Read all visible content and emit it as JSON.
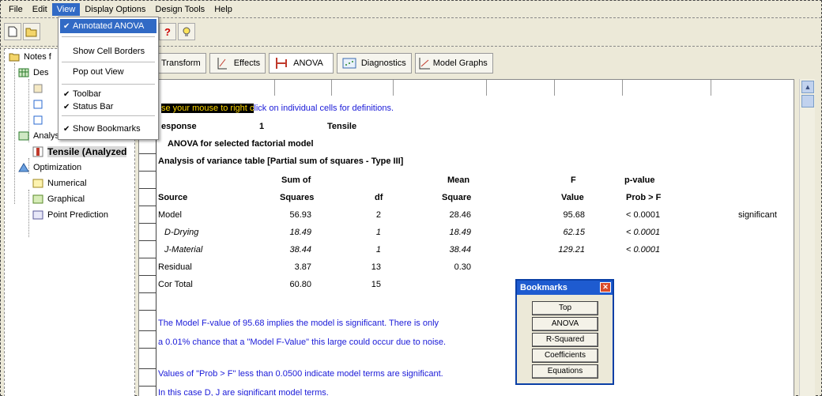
{
  "menubar": {
    "items": [
      "File",
      "Edit",
      "View",
      "Display Options",
      "Design Tools",
      "Help"
    ]
  },
  "view_menu": {
    "items": [
      {
        "label": "Annotated ANOVA",
        "checked": true
      },
      {
        "label": "Show Cell Borders",
        "checked": false
      },
      {
        "label": "Pop out View",
        "checked": false
      },
      {
        "label": "Toolbar",
        "checked": true
      },
      {
        "label": "Status Bar",
        "checked": true
      },
      {
        "label": "Show Bookmarks",
        "checked": true
      }
    ]
  },
  "tree": {
    "items": [
      {
        "label": "Notes f",
        "icon": "folder-icon"
      },
      {
        "label": "Des",
        "icon": "design-grid-icon"
      },
      {
        "label": "Analysis",
        "icon": "analysis-icon"
      },
      {
        "label": "Tensile (Analyzed",
        "icon": "tensile-icon"
      },
      {
        "label": "Optimization",
        "icon": "optimization-icon"
      },
      {
        "label": "Numerical",
        "icon": "numerical-icon"
      },
      {
        "label": "Graphical",
        "icon": "graphical-icon"
      },
      {
        "label": "Point Prediction",
        "icon": "point-prediction-icon"
      }
    ]
  },
  "tabs": [
    {
      "label": "Transform",
      "icon": "transform-icon"
    },
    {
      "label": "Effects",
      "icon": "effects-icon"
    },
    {
      "label": "ANOVA",
      "icon": "anova-icon"
    },
    {
      "label": "Diagnostics",
      "icon": "diagnostics-icon"
    },
    {
      "label": "Model Graphs",
      "icon": "model-graphs-icon"
    }
  ],
  "report": {
    "hint_prefix": "se your mouse to right c",
    "hint_suffix": "lick on individual cells for definitions.",
    "response_label": "esponse",
    "response_num": "1",
    "response_name": "Tensile",
    "model_title": "ANOVA for selected factorial model",
    "table_title": "Analysis of variance table [Partial sum of squares - Type III]",
    "head1": {
      "sum": "Sum of",
      "mean": "Mean",
      "f": "F",
      "p": "p-value"
    },
    "head2": {
      "source": "Source",
      "sum": "Squares",
      "df": "df",
      "mean": "Square",
      "f": "Value",
      "p": "Prob > F"
    },
    "rows": [
      {
        "source": "Model",
        "sum": "56.93",
        "df": "2",
        "mean": "28.46",
        "f": "95.68",
        "p": "< 0.0001",
        "note": "significant"
      },
      {
        "source": "D-Drying",
        "sum": "18.49",
        "df": "1",
        "mean": "18.49",
        "f": "62.15",
        "p": "< 0.0001",
        "note": ""
      },
      {
        "source": "J-Material",
        "sum": "38.44",
        "df": "1",
        "mean": "38.44",
        "f": "129.21",
        "p": "< 0.0001",
        "note": ""
      },
      {
        "source": "Residual",
        "sum": "3.87",
        "df": "13",
        "mean": "0.30",
        "f": "",
        "p": "",
        "note": ""
      },
      {
        "source": "Cor Total",
        "sum": "60.80",
        "df": "15",
        "mean": "",
        "f": "",
        "p": "",
        "note": ""
      }
    ],
    "notes": [
      "The Model F-value of 95.68 implies the model is significant.  There is only",
      "a 0.01% chance that a \"Model F-Value\" this large could occur due to noise.",
      "Values of \"Prob > F\" less than 0.0500 indicate model terms are significant.",
      "In this case D, J are significant model terms."
    ]
  },
  "bookmarks": {
    "title": "Bookmarks",
    "buttons": [
      "Top",
      "ANOVA",
      "R-Squared",
      "Coefficients",
      "Equations"
    ]
  }
}
